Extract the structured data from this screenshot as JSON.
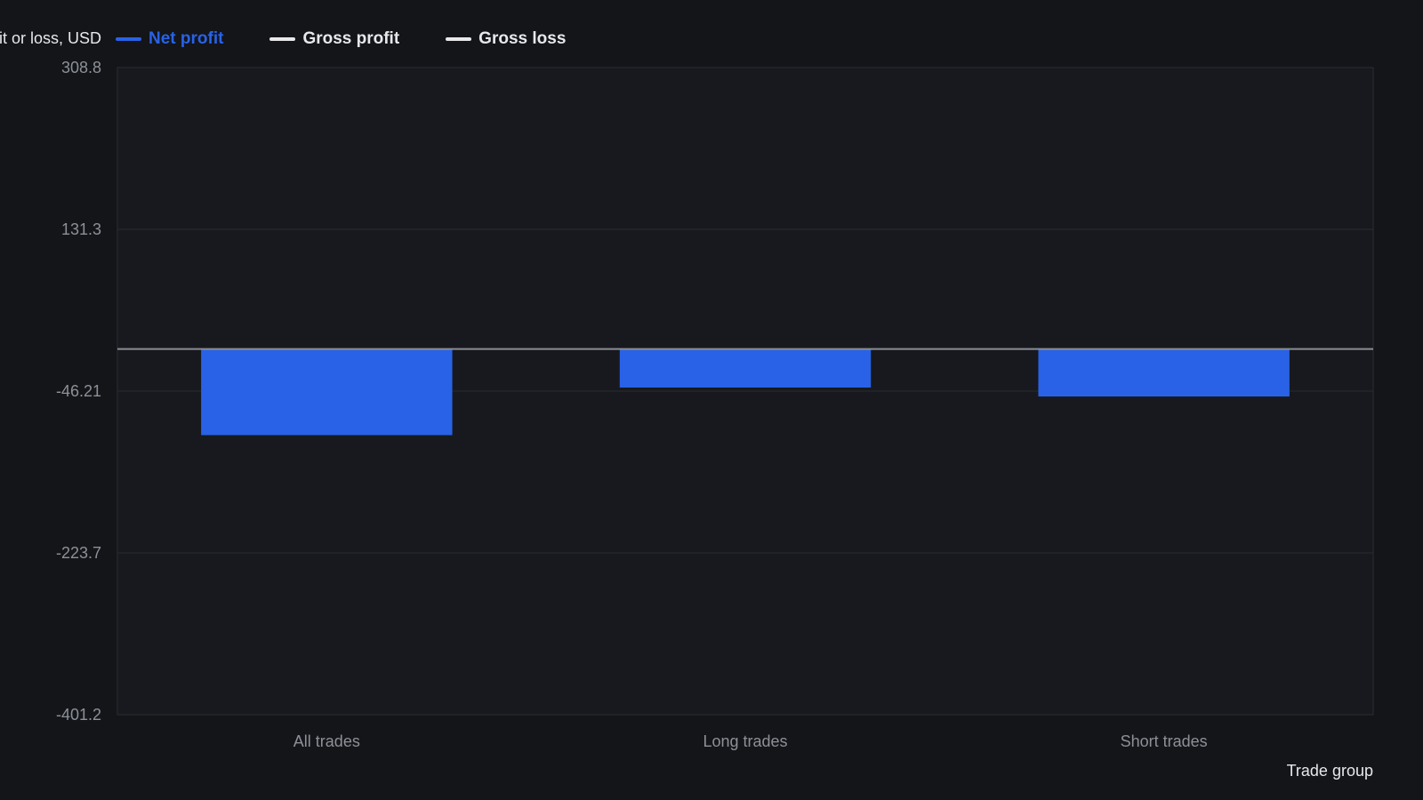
{
  "chart_data": {
    "type": "bar",
    "ylabel": "Net profit or loss, USD",
    "xlabel": "Trade group",
    "categories": [
      "All trades",
      "Long trades",
      "Short trades"
    ],
    "series": [
      {
        "name": "Net profit",
        "values": [
          -94.5,
          -42.3,
          -52.1
        ],
        "color": "#2962e6"
      }
    ],
    "legend": [
      {
        "name": "Net profit",
        "color": "#2962e6",
        "active": true
      },
      {
        "name": "Gross profit",
        "color": "#e8e8ea",
        "active": false
      },
      {
        "name": "Gross loss",
        "color": "#e8e8ea",
        "active": false
      }
    ],
    "yticks": [
      "308.8",
      "131.3",
      "-46.21",
      "-223.7",
      "-401.2"
    ],
    "ylim": [
      -401.2,
      308.8
    ],
    "grid": true,
    "legend_position": "top-left"
  }
}
